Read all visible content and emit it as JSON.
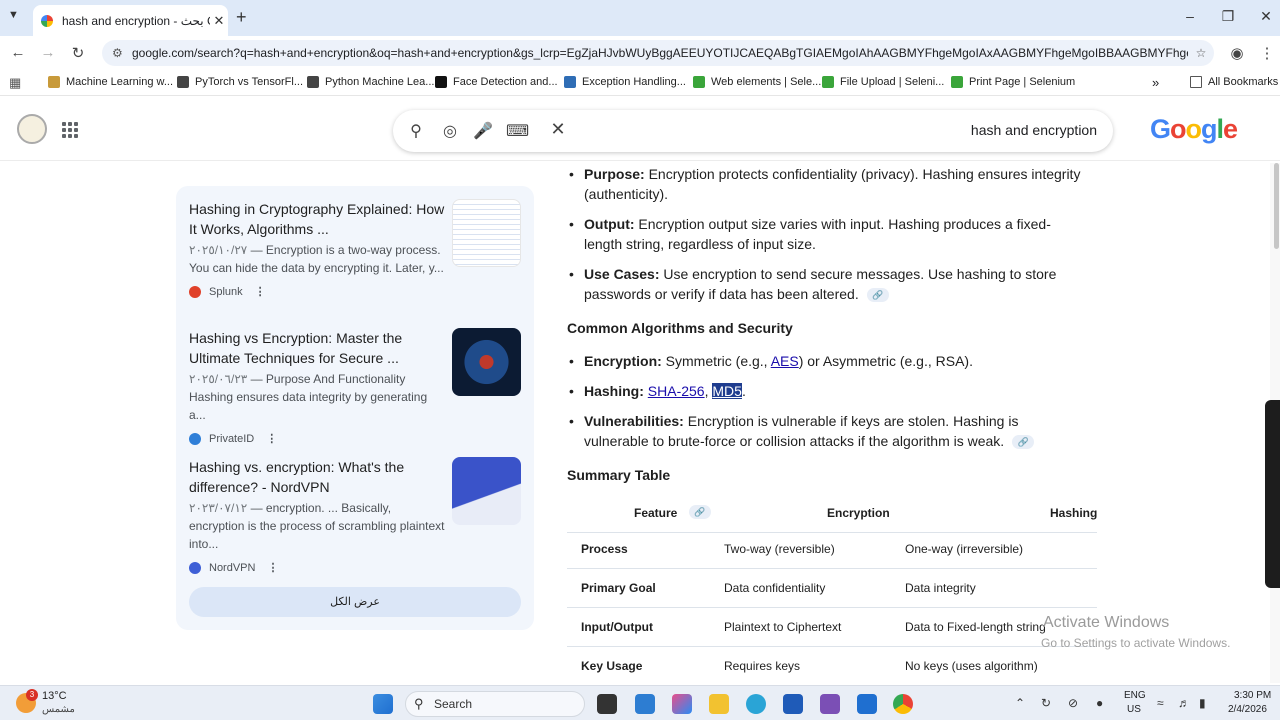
{
  "browser": {
    "tab_title": "hash and encryption - بحث Goo...",
    "new_tab": "+",
    "url": "google.com/search?q=hash+and+encryption&oq=hash+and+encryption&gs_lcrp=EgZjaHJvbWUyBggAEEUYOTIJCAEQABgTGIAEMgoIAhAAGBMYFhgeMgoIAxAAGBMYFhgeMgoIBBAAGBMYFhgeMgoI..."
  },
  "bookmarks": [
    {
      "label": "Machine Learning w...",
      "color": "#c89a3a"
    },
    {
      "label": "PyTorch vs TensorFl...",
      "color": "#444"
    },
    {
      "label": "Python Machine Lea...",
      "color": "#444"
    },
    {
      "label": "Face Detection and...",
      "color": "#111"
    },
    {
      "label": "Exception Handling...",
      "color": "#2f6db5"
    },
    {
      "label": "Web elements | Sele...",
      "color": "#3aa53a"
    },
    {
      "label": "File Upload | Seleni...",
      "color": "#3aa53a"
    },
    {
      "label": "Print Page | Selenium",
      "color": "#3aa53a"
    }
  ],
  "bookmarks_more": "»",
  "all_bookmarks": "All Bookmarks",
  "search": {
    "query": "hash and encryption",
    "logo": "Google"
  },
  "results": [
    {
      "title": "Hashing in Cryptography Explained: How It Works, Algorithms ...",
      "date": "٢٠٢٥/١٠/٢٧",
      "snippet": " — Encryption is a two-way process. You can hide the data by encrypting it. Later, y...",
      "source": "Splunk",
      "source_color": "#e0412a"
    },
    {
      "title": "Hashing vs Encryption: Master the Ultimate Techniques for Secure ...",
      "date": "٢٠٢٥/٠٦/٢٣",
      "snippet": " — Purpose And Functionality Hashing ensures data integrity by generating a...",
      "source": "PrivateID",
      "source_color": "#2f7fd8"
    },
    {
      "title": "Hashing vs. encryption: What's the difference? - NordVPN",
      "date": "٢٠٢٣/٠٧/١٢",
      "snippet": " — encryption. ... Basically, encryption is the process of scrambling plaintext into...",
      "source": "NordVPN",
      "source_color": "#3e5fd6"
    }
  ],
  "show_all": "عرض الكل",
  "main": {
    "bullets_top": [
      {
        "label": "Purpose:",
        "text": " Encryption protects confidentiality (privacy). Hashing ensures integrity (authenticity)."
      },
      {
        "label": "Output:",
        "text": " Encryption output size varies with input. Hashing produces a fixed-length string, regardless of input size."
      },
      {
        "label": "Use Cases:",
        "text": " Use encryption to send secure messages. Use hashing to store passwords or verify if data has been altered."
      }
    ],
    "section_algorithms": "Common Algorithms and Security",
    "enc_label": "Encryption:",
    "enc_pre": " Symmetric (e.g., ",
    "enc_link": "AES",
    "enc_post": ") or Asymmetric (e.g., RSA).",
    "hash_label": "Hashing:",
    "hash_link1": "SHA-256",
    "hash_sep": ", ",
    "hash_link2": "MD5",
    "hash_end": ".",
    "vuln_label": "Vulnerabilities:",
    "vuln_text": " Encryption is vulnerable if keys are stolen. Hashing is vulnerable to brute-force or collision attacks if the algorithm is weak.",
    "section_summary": "Summary Table",
    "table": {
      "headers": [
        "Feature",
        "Encryption",
        "Hashing"
      ],
      "rows": [
        [
          "Process",
          "Two-way (reversible)",
          "One-way (irreversible)"
        ],
        [
          "Primary Goal",
          "Data confidentiality",
          "Data integrity"
        ],
        [
          "Input/Output",
          "Plaintext to Ciphertext",
          "Data to Fixed-length string"
        ],
        [
          "Key Usage",
          "Requires keys",
          "No keys (uses algorithm)"
        ]
      ]
    }
  },
  "watermark": {
    "line1": "Activate Windows",
    "line2": "Go to Settings to activate Windows."
  },
  "taskbar": {
    "temp": "13°C",
    "condition": "مشمس",
    "badge": "3",
    "search": "Search",
    "lang1": "ENG",
    "lang2": "US",
    "time": "3:30 PM",
    "date": "2/4/2026"
  }
}
